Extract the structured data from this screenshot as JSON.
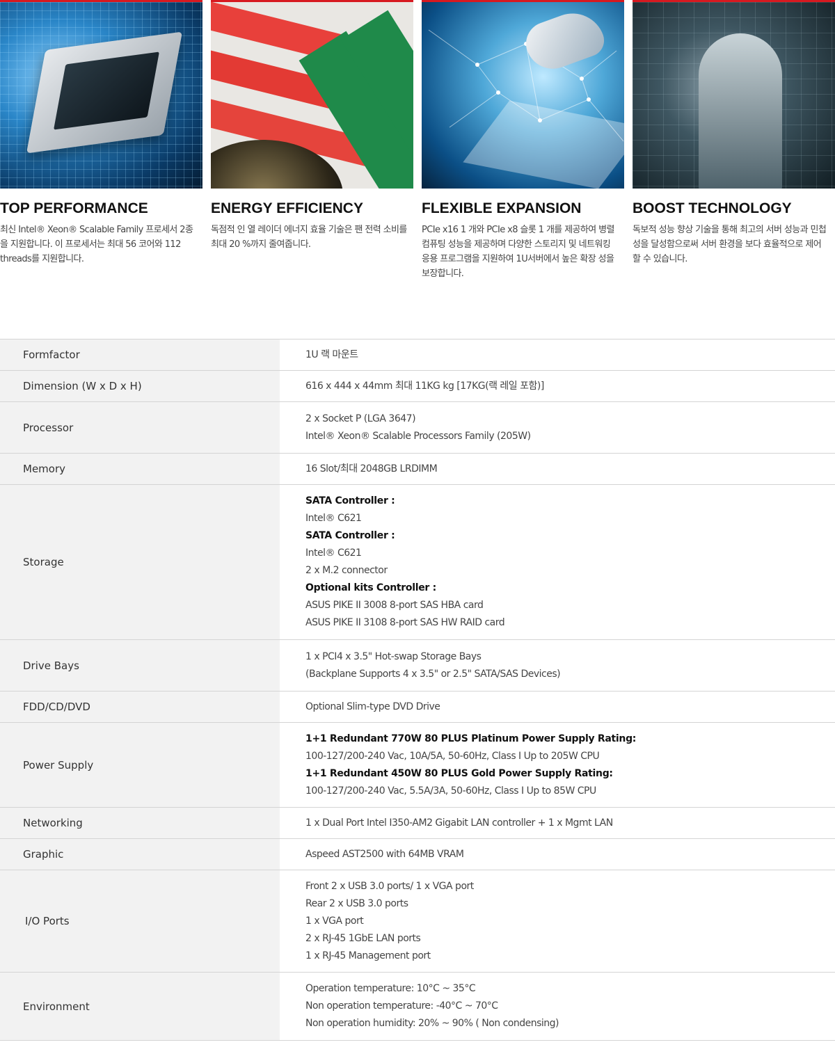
{
  "features": [
    {
      "title": "TOP PERFORMANCE",
      "desc": "최신 Intel® Xeon® Scalable Family 프로세서 2종을 지원합니다. 이 프로세서는 최대 56 코어와 112 threads를 지원합니다."
    },
    {
      "title": "ENERGY EFFICIENCY",
      "desc": "독점적 인 열 레이더 에너지 효율 기술은 팬 전력 소비를 최대 20 %까지 줄여줍니다."
    },
    {
      "title": "FLEXIBLE EXPANSION",
      "desc": "PCIe x16 1 개와 PCIe x8 슬롯 1 개를 제공하여 병렬 컴퓨팅 성능을 제공하며 다양한 스토리지 및 네트워킹 응용 프로그램을 지원하여 1U서버에서 높은 확장 성을 보장합니다."
    },
    {
      "title": "BOOST TECHNOLOGY",
      "desc": "독보적 성능 향상 기술을 통해 최고의 서버 성능과 민첩성을 달성함으로써 서버 환경을 보다 효율적으로 제어 할 수 있습니다."
    }
  ],
  "specs": [
    {
      "label": "Formfactor",
      "lines": [
        {
          "t": "1U 랙 마운트"
        }
      ]
    },
    {
      "label": "Dimension (W x D x H)",
      "lines": [
        {
          "t": "616 x 444 x 44mm 최대 11KG kg [17KG(랙 레일 포함)]"
        }
      ]
    },
    {
      "label": "Processor",
      "lines": [
        {
          "t": "2 x Socket P (LGA 3647)"
        },
        {
          "t": "Intel® Xeon® Scalable Processors Family (205W)"
        }
      ]
    },
    {
      "label": "Memory",
      "lines": [
        {
          "t": "16 Slot/최대  2048GB LRDIMM"
        }
      ]
    },
    {
      "label": "Storage",
      "lines": [
        {
          "t": "SATA Controller :",
          "bold": true
        },
        {
          "t": "Intel® C621"
        },
        {
          "t": "SATA Controller :",
          "bold": true
        },
        {
          "t": "Intel® C621"
        },
        {
          "t": "2 x M.2 connector"
        },
        {
          "t": "Optional kits Controller :",
          "bold": true
        },
        {
          "t": "ASUS PIKE II 3008 8-port SAS HBA card"
        },
        {
          "t": "ASUS PIKE II 3108 8-port SAS HW RAID card"
        }
      ]
    },
    {
      "label": "Drive Bays",
      "lines": [
        {
          "t": "1 x PCI4 x 3.5\" Hot-swap Storage Bays"
        },
        {
          "t": "(Backplane Supports 4 x 3.5\" or 2.5\" SATA/SAS Devices)"
        }
      ]
    },
    {
      "label": "FDD/CD/DVD",
      "lines": [
        {
          "t": "Optional Slim-type DVD Drive"
        }
      ]
    },
    {
      "label": "Power Supply",
      "lines": [
        {
          "t": "1+1 Redundant 770W 80 PLUS Platinum Power Supply Rating:",
          "bold": true
        },
        {
          "t": "100-127/200-240 Vac, 10A/5A, 50-60Hz, Class I Up to 205W CPU"
        },
        {
          "t": "1+1 Redundant 450W 80 PLUS Gold Power Supply Rating:",
          "bold": true
        },
        {
          "t": "100-127/200-240 Vac, 5.5A/3A, 50-60Hz, Class I Up to 85W CPU"
        }
      ]
    },
    {
      "label": "Networking",
      "lines": [
        {
          "t": "1 x Dual Port Intel I350-AM2 Gigabit LAN controller + 1 x Mgmt LAN"
        }
      ]
    },
    {
      "label": "Graphic",
      "lines": [
        {
          "t": "Aspeed AST2500 with 64MB VRAM"
        }
      ]
    },
    {
      "label": "I/O Ports",
      "lines": [
        {
          "t": "Front 2 x USB 3.0 ports/ 1 x VGA port"
        },
        {
          "t": "Rear 2 x USB 3.0 ports"
        },
        {
          "t": "1 x VGA port"
        },
        {
          "t": "2 x RJ-45 1GbE LAN ports"
        },
        {
          "t": "1 x RJ-45 Management port"
        }
      ]
    },
    {
      "label": "Environment",
      "lines": [
        {
          "t": "Operation temperature: 10°C ~ 35°C"
        },
        {
          "t": "Non operation temperature: -40°C ~ 70°C"
        },
        {
          "t": "Non operation humidity: 20% ~ 90% ( Non condensing)"
        }
      ]
    }
  ]
}
